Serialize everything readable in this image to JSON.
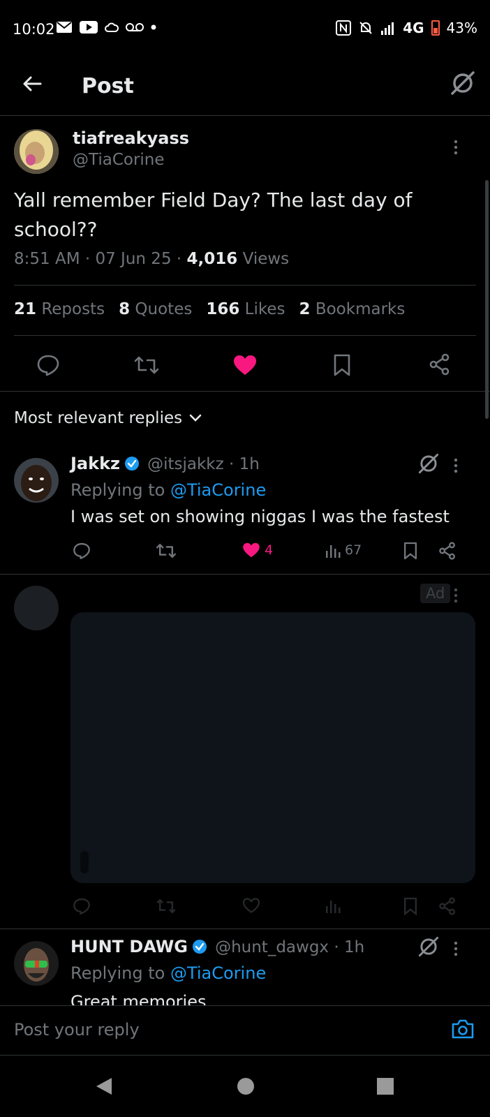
{
  "status": {
    "time": "10:02",
    "network": "4G",
    "battery": "43%"
  },
  "header": {
    "title": "Post"
  },
  "post": {
    "display_name": "tiafreakyass",
    "handle": "@TiaCorine",
    "text_line1": "Yall remember Field Day? The last day of",
    "text_line2": "school??",
    "time": "8:51 AM",
    "date": "07 Jun 25",
    "views_count": "4,016",
    "views_label": "Views",
    "reposts_count": "21",
    "reposts_label": "Reposts",
    "quotes_count": "8",
    "quotes_label": "Quotes",
    "likes_count": "166",
    "likes_label": "Likes",
    "bookmarks_count": "2",
    "bookmarks_label": "Bookmarks",
    "liked": true,
    "like_color": "#f91880"
  },
  "sort": {
    "label": "Most relevant replies"
  },
  "replies": [
    {
      "display_name": "Jakkz",
      "handle": "@itsjakkz",
      "age": "1h",
      "replying_to_label": "Replying to",
      "replying_to": "@TiaCorine",
      "text": "I was set on showing niggas I was the fastest",
      "likes": "4",
      "views": "67"
    },
    {
      "display_name": "HUNT DAWG",
      "handle": "@hunt_dawgx",
      "age": "1h",
      "replying_to_label": "Replying to",
      "replying_to": "@TiaCorine",
      "text": "Great memories"
    }
  ],
  "ad": {
    "badge": "Ad"
  },
  "reply_box": {
    "placeholder": "Post your reply"
  },
  "colors": {
    "accent": "#1d9bf0",
    "like": "#f91880",
    "divider": "#2f3336"
  }
}
